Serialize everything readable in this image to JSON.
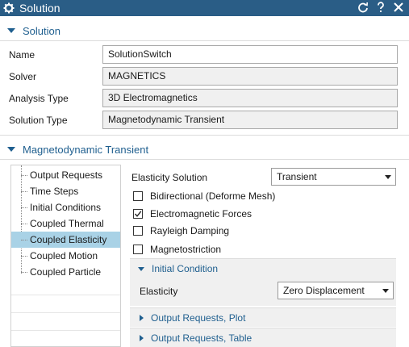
{
  "window": {
    "title": "Solution",
    "icons": [
      "gear-icon",
      "reset-icon",
      "help-icon",
      "close-icon"
    ]
  },
  "solution_section": {
    "header": "Solution",
    "fields": [
      {
        "label": "Name",
        "value": "SolutionSwitch",
        "editable": true
      },
      {
        "label": "Solver",
        "value": "MAGNETICS",
        "editable": false
      },
      {
        "label": "Analysis Type",
        "value": "3D Electromagnetics",
        "editable": false
      },
      {
        "label": "Solution Type",
        "value": "Magnetodynamic Transient",
        "editable": false
      }
    ]
  },
  "transient_section": {
    "header": "Magnetodynamic Transient",
    "tree": {
      "items": [
        {
          "label": "Output Requests",
          "selected": false
        },
        {
          "label": "Time Steps",
          "selected": false
        },
        {
          "label": "Initial Conditions",
          "selected": false
        },
        {
          "label": "Coupled Thermal",
          "selected": false
        },
        {
          "label": "Coupled Elasticity",
          "selected": true
        },
        {
          "label": "Coupled Motion",
          "selected": false
        },
        {
          "label": "Coupled Particle",
          "selected": false
        }
      ]
    },
    "props": {
      "elasticity_solution_label": "Elasticity Solution",
      "elasticity_solution_value": "Transient",
      "checkboxes": [
        {
          "label": "Bidirectional (Deforme Mesh)",
          "checked": false
        },
        {
          "label": "Electromagnetic Forces",
          "checked": true
        },
        {
          "label": "Rayleigh Damping",
          "checked": false
        },
        {
          "label": "Magnetostriction",
          "checked": false
        }
      ],
      "initial_condition": {
        "header": "Initial Condition",
        "elasticity_label": "Elasticity",
        "elasticity_value": "Zero Displacement"
      },
      "output_requests_plot": "Output Requests, Plot",
      "output_requests_table": "Output Requests, Table"
    }
  },
  "colors": {
    "titlebar": "#2a5d86",
    "accent": "#1f5f8f",
    "selection": "#a9d2e6",
    "panel_bg": "#f0f0f0"
  }
}
